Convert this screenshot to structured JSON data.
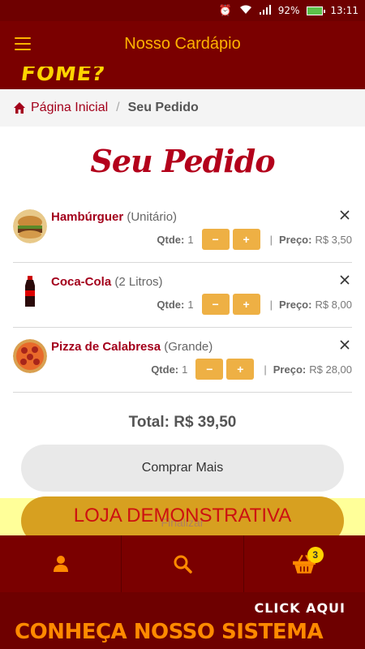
{
  "status_bar": {
    "battery": "92%",
    "time": "13:11"
  },
  "app_bar": {
    "title": "Nosso Cardápio"
  },
  "banner": {
    "text": "FOME?"
  },
  "breadcrumb": {
    "home": "Página Inicial",
    "separator": "/",
    "current": "Seu Pedido"
  },
  "page_heading": "Seu Pedido",
  "order_items": [
    {
      "name": "Hambúrguer",
      "size": "(Unitário)",
      "qty_label": "Qtde:",
      "qty": "1",
      "minus": "−",
      "plus": "+",
      "price_label": "Preço:",
      "price": "R$ 3,50"
    },
    {
      "name": "Coca-Cola",
      "size": "(2 Litros)",
      "qty_label": "Qtde:",
      "qty": "1",
      "minus": "−",
      "plus": "+",
      "price_label": "Preço:",
      "price": "R$ 8,00"
    },
    {
      "name": "Pizza de Calabresa",
      "size": "(Grande)",
      "qty_label": "Qtde:",
      "qty": "1",
      "minus": "−",
      "plus": "+",
      "price_label": "Preço:",
      "price": "R$ 28,00"
    }
  ],
  "total": "Total: R$ 39,50",
  "buy_more_label": "Comprar Mais",
  "finish_label": "Finalizar",
  "demo_text": "LOJA DEMONSTRATIVA",
  "bottom_nav": {
    "cart_count": "3"
  },
  "promo": {
    "click": "CLICK AQUI",
    "main": "CONHEÇA NOSSO SISTEMA"
  },
  "colors": {
    "brand": "#7a0000",
    "accent": "#ffb300",
    "qty_button": "#eeb044",
    "item_name": "#a3001b"
  }
}
